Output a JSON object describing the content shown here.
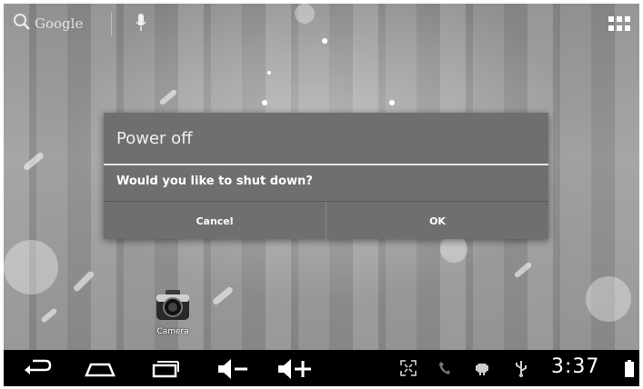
{
  "home": {
    "search_label": "Google",
    "camera_label": "Camera"
  },
  "dialog": {
    "title": "Power off",
    "message": "Would you like to shut down?",
    "cancel_label": "Cancel",
    "ok_label": "OK"
  },
  "status": {
    "time": "3:37"
  },
  "colors": {
    "dialog_bg": "#6f6f6f",
    "navbar_bg": "#000000"
  }
}
